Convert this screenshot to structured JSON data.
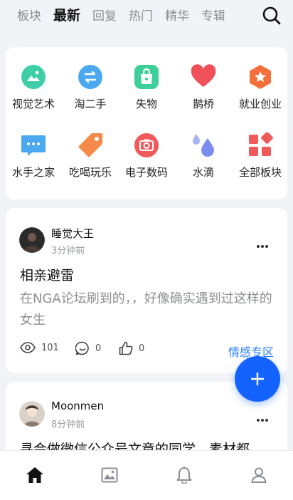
{
  "header": {
    "tabs": [
      {
        "label": "板块"
      },
      {
        "label": "最新"
      },
      {
        "label": "回复"
      },
      {
        "label": "热门"
      },
      {
        "label": "精华"
      },
      {
        "label": "专辑"
      }
    ],
    "active_tab": "最新"
  },
  "boards": [
    {
      "label": "视觉艺术",
      "icon": "palette-icon",
      "color": "#3ecfa8"
    },
    {
      "label": "淘二手",
      "icon": "exchange-icon",
      "color": "#4aa8f0"
    },
    {
      "label": "失物",
      "icon": "bag-icon",
      "color": "#3fcf9a"
    },
    {
      "label": "鹊桥",
      "icon": "heart-icon",
      "color": "#f0505a"
    },
    {
      "label": "就业创业",
      "icon": "star-hexagon-icon",
      "color": "#f46f3a"
    },
    {
      "label": "水手之家",
      "icon": "chat-bubble-icon",
      "color": "#4aa8f0"
    },
    {
      "label": "吃喝玩乐",
      "icon": "tag-icon",
      "color": "#f58a4a"
    },
    {
      "label": "电子数码",
      "icon": "camera-icon",
      "color": "#f05a5a"
    },
    {
      "label": "水滴",
      "icon": "water-drops-icon",
      "color": "#7a8cf0"
    },
    {
      "label": "全部板块",
      "icon": "grid-icon",
      "color": "#f05a5a"
    }
  ],
  "posts": [
    {
      "author": "睡觉大王",
      "time": "3分钟前",
      "title": "相亲避雷",
      "excerpt": "在NGA论坛刷到的，，好像确实遇到过这样的女生",
      "views": "101",
      "comments": "0",
      "likes": "0",
      "category": "情感专区"
    },
    {
      "author": "Moonmen",
      "time": "8分钟前",
      "title": "寻会做微信公众号文章的同学，素材都"
    }
  ],
  "colors": {
    "accent": "#1463ff",
    "link": "#2a7dff",
    "background": "#f2f3f7"
  }
}
